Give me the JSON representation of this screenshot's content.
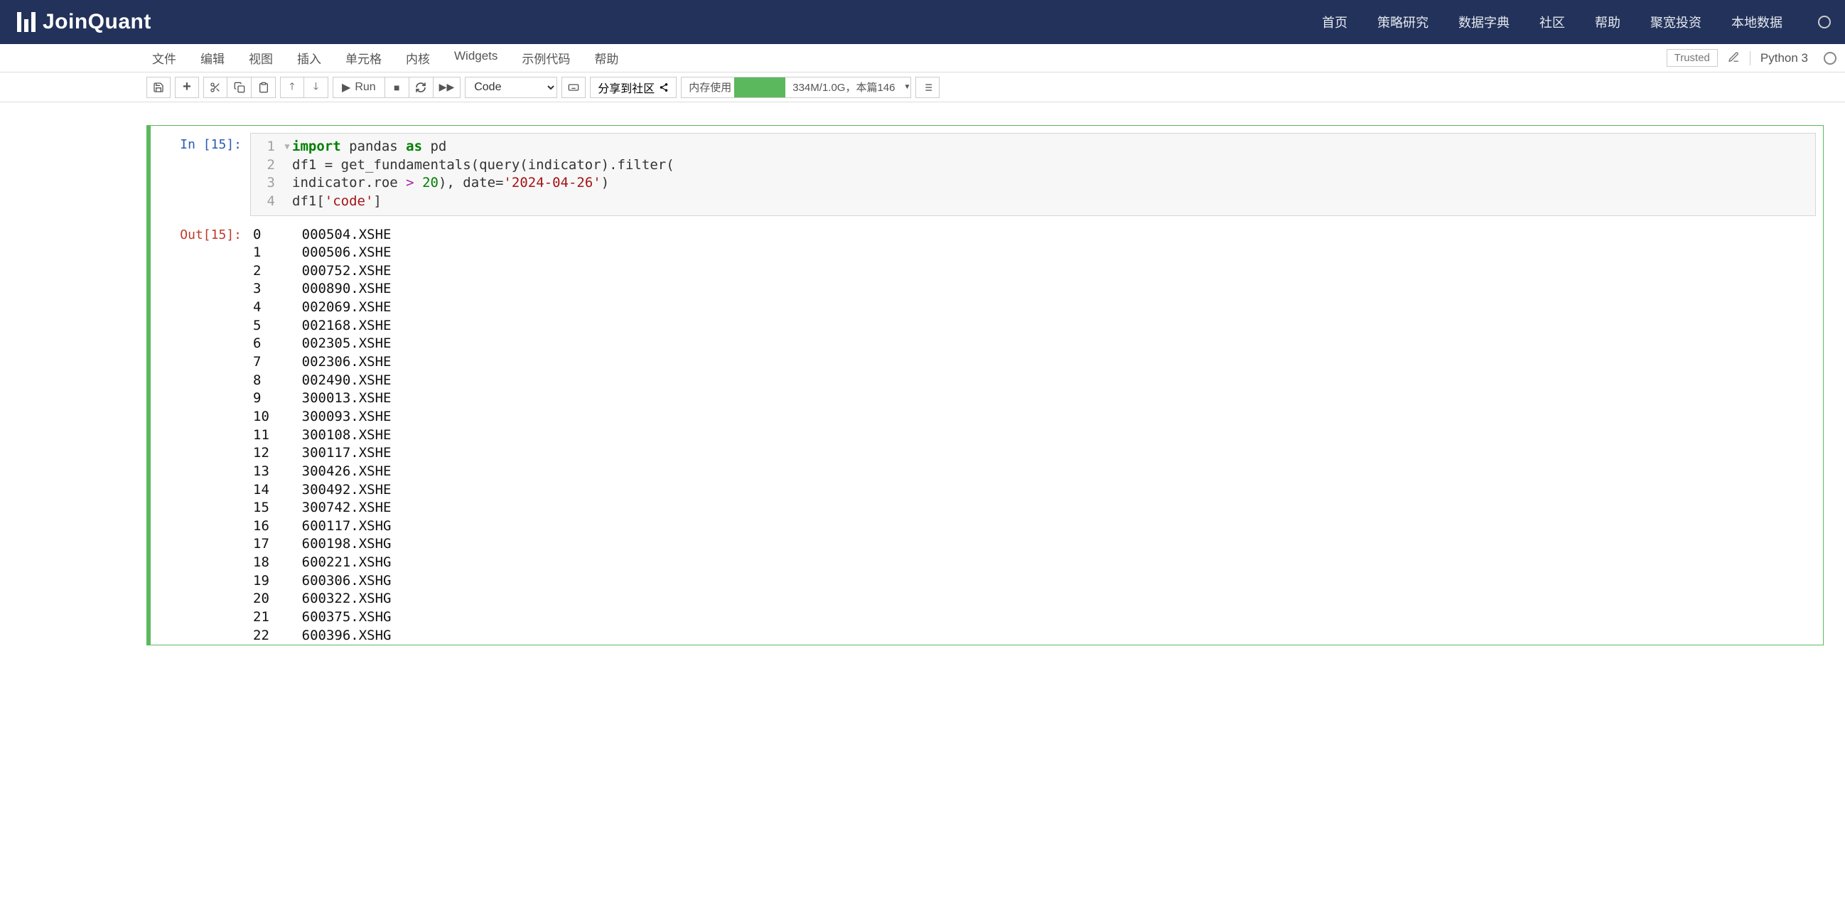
{
  "brand": "JoinQuant",
  "topnav": [
    "首页",
    "策略研究",
    "数据字典",
    "社区",
    "帮助",
    "聚宽投资",
    "本地数据"
  ],
  "menubar": [
    "文件",
    "编辑",
    "视图",
    "插入",
    "单元格",
    "内核",
    "Widgets",
    "示例代码",
    "帮助"
  ],
  "trusted": "Trusted",
  "kernel": "Python 3",
  "toolbar": {
    "run": "Run",
    "cell_type": "Code",
    "share": "分享到社区",
    "mem_label": "内存使用",
    "mem_text": "334M/1.0G，本篇146"
  },
  "cell": {
    "in_prompt": "In [15]:",
    "out_prompt": "Out[15]:",
    "code": {
      "l1": {
        "kw1": "import",
        "t1": " pandas ",
        "kw2": "as",
        "t2": " pd"
      },
      "l2": "df1 = get_fundamentals(query(indicator).filter(",
      "l3": {
        "t1": "indicator.roe ",
        "op": ">",
        "t2": " ",
        "num": "20",
        "t3": "), date=",
        "str": "'2024-04-26'",
        "t4": ")"
      },
      "l4": {
        "t1": "df1[",
        "str": "'code'",
        "t2": "]"
      }
    },
    "output_rows": [
      {
        "idx": "0",
        "val": "000504.XSHE"
      },
      {
        "idx": "1",
        "val": "000506.XSHE"
      },
      {
        "idx": "2",
        "val": "000752.XSHE"
      },
      {
        "idx": "3",
        "val": "000890.XSHE"
      },
      {
        "idx": "4",
        "val": "002069.XSHE"
      },
      {
        "idx": "5",
        "val": "002168.XSHE"
      },
      {
        "idx": "6",
        "val": "002305.XSHE"
      },
      {
        "idx": "7",
        "val": "002306.XSHE"
      },
      {
        "idx": "8",
        "val": "002490.XSHE"
      },
      {
        "idx": "9",
        "val": "300013.XSHE"
      },
      {
        "idx": "10",
        "val": "300093.XSHE"
      },
      {
        "idx": "11",
        "val": "300108.XSHE"
      },
      {
        "idx": "12",
        "val": "300117.XSHE"
      },
      {
        "idx": "13",
        "val": "300426.XSHE"
      },
      {
        "idx": "14",
        "val": "300492.XSHE"
      },
      {
        "idx": "15",
        "val": "300742.XSHE"
      },
      {
        "idx": "16",
        "val": "600117.XSHG"
      },
      {
        "idx": "17",
        "val": "600198.XSHG"
      },
      {
        "idx": "18",
        "val": "600221.XSHG"
      },
      {
        "idx": "19",
        "val": "600306.XSHG"
      },
      {
        "idx": "20",
        "val": "600322.XSHG"
      },
      {
        "idx": "21",
        "val": "600375.XSHG"
      },
      {
        "idx": "22",
        "val": "600396.XSHG"
      }
    ]
  }
}
